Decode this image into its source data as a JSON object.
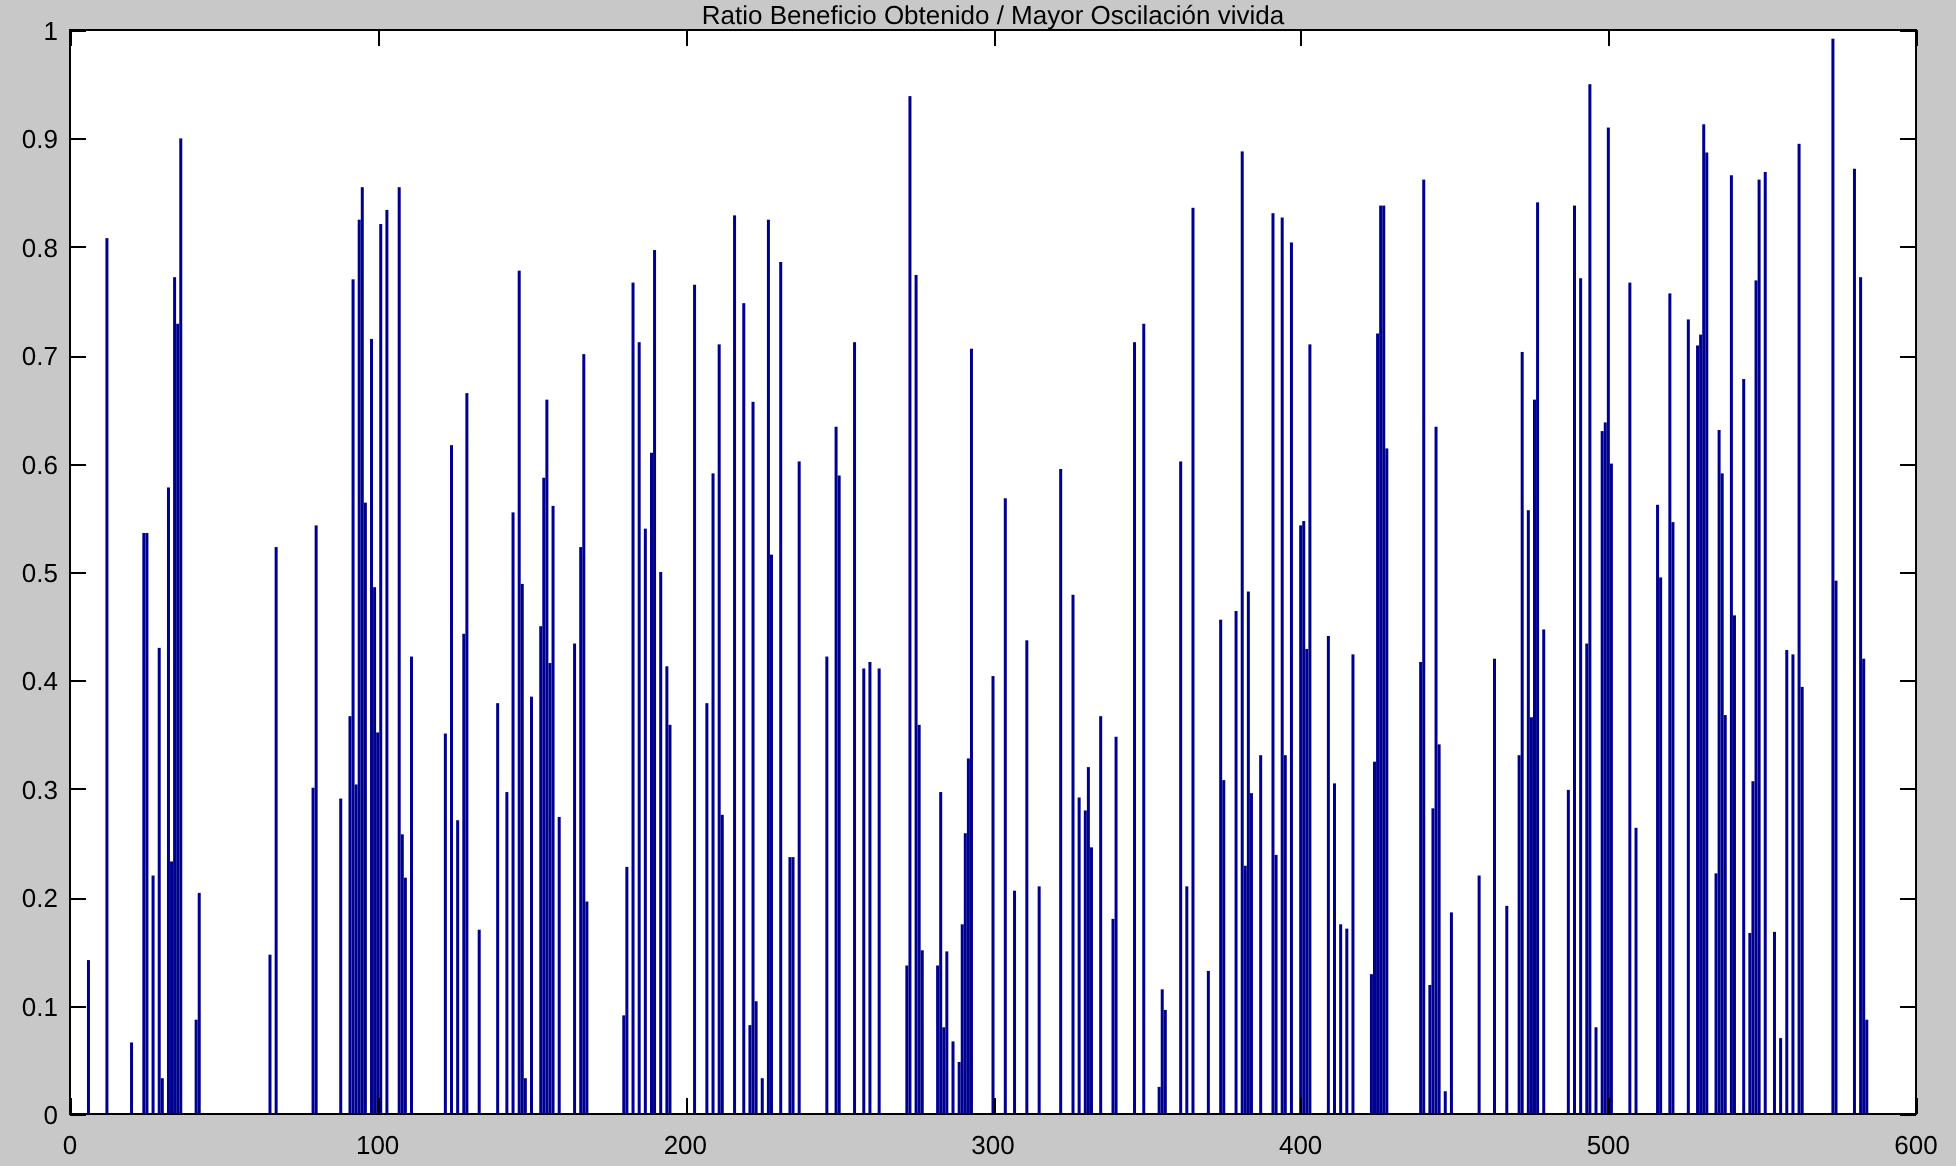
{
  "figure": {
    "chart_data": {
      "type": "bar",
      "title": "Ratio Beneficio Obtenido / Mayor Oscilación vivida",
      "xlim": [
        0,
        600
      ],
      "ylim": [
        0,
        1
      ],
      "xticks": [
        0,
        100,
        200,
        300,
        400,
        500,
        600
      ],
      "yticks": [
        0,
        0.1,
        0.2,
        0.3,
        0.4,
        0.5,
        0.6,
        0.7,
        0.8,
        0.9,
        1
      ],
      "x": [
        6,
        12,
        20,
        24,
        25,
        27,
        29,
        30,
        32,
        33,
        34,
        35,
        36,
        41,
        42,
        65,
        67,
        79,
        80,
        88,
        91,
        92,
        93,
        94,
        95,
        96,
        98,
        99,
        100,
        101,
        103,
        107,
        108,
        109,
        111,
        122,
        124,
        126,
        128,
        129,
        133,
        139,
        142,
        144,
        146,
        147,
        148,
        150,
        153,
        154,
        155,
        156,
        157,
        159,
        164,
        166,
        167,
        168,
        180,
        181,
        183,
        185,
        187,
        189,
        190,
        192,
        194,
        195,
        203,
        207,
        209,
        211,
        212,
        216,
        219,
        221,
        222,
        223,
        225,
        227,
        228,
        231,
        234,
        235,
        237,
        246,
        249,
        250,
        255,
        258,
        260,
        263,
        272,
        273,
        275,
        276,
        277,
        282,
        283,
        284,
        285,
        287,
        289,
        290,
        291,
        292,
        293,
        300,
        304,
        307,
        311,
        315,
        322,
        326,
        328,
        330,
        331,
        332,
        335,
        339,
        340,
        346,
        349,
        354,
        355,
        356,
        361,
        363,
        365,
        370,
        374,
        375,
        379,
        381,
        382,
        383,
        384,
        387,
        391,
        392,
        394,
        395,
        397,
        400,
        401,
        402,
        403,
        409,
        411,
        413,
        415,
        417,
        423,
        424,
        425,
        426,
        427,
        428,
        439,
        440,
        442,
        443,
        444,
        445,
        447,
        449,
        458,
        463,
        467,
        471,
        472,
        474,
        475,
        476,
        477,
        479,
        487,
        489,
        491,
        493,
        494,
        496,
        498,
        499,
        500,
        501,
        507,
        509,
        516,
        517,
        520,
        521,
        526,
        529,
        530,
        531,
        532,
        535,
        536,
        537,
        538,
        540,
        541,
        544,
        546,
        547,
        548,
        549,
        551,
        554,
        556,
        558,
        560,
        562,
        563,
        573,
        574,
        580,
        582,
        583,
        584
      ],
      "series": [
        {
          "color": "#00008f",
          "values": [
            0.142,
            0.808,
            0.066,
            0.536,
            0.536,
            0.22,
            0.43,
            0.033,
            0.578,
            0.233,
            0.772,
            0.729,
            0.9,
            0.087,
            0.204,
            0.147,
            0.523,
            0.301,
            0.543,
            0.291,
            0.367,
            0.77,
            0.304,
            0.825,
            0.855,
            0.564,
            0.715,
            0.486,
            0.352,
            0.821,
            0.834,
            0.855,
            0.258,
            0.218,
            0.422,
            0.351,
            0.617,
            0.271,
            0.443,
            0.665,
            0.17,
            0.379,
            0.297,
            0.555,
            0.778,
            0.489,
            0.033,
            0.385,
            0.45,
            0.587,
            0.659,
            0.416,
            0.561,
            0.274,
            0.434,
            0.523,
            0.701,
            0.196,
            0.091,
            0.228,
            0.767,
            0.712,
            0.54,
            0.61,
            0.797,
            0.5,
            0.413,
            0.359,
            0.765,
            0.379,
            0.591,
            0.71,
            0.276,
            0.829,
            0.748,
            0.082,
            0.657,
            0.104,
            0.033,
            0.825,
            0.516,
            0.786,
            0.237,
            0.237,
            0.602,
            0.422,
            0.634,
            0.589,
            0.712,
            0.411,
            0.417,
            0.411,
            0.137,
            0.939,
            0.774,
            0.359,
            0.151,
            0.137,
            0.297,
            0.08,
            0.15,
            0.067,
            0.048,
            0.175,
            0.259,
            0.328,
            0.706,
            0.404,
            0.568,
            0.206,
            0.437,
            0.21,
            0.595,
            0.479,
            0.292,
            0.28,
            0.32,
            0.246,
            0.367,
            0.18,
            0.348,
            0.712,
            0.729,
            0.025,
            0.115,
            0.096,
            0.602,
            0.21,
            0.836,
            0.132,
            0.456,
            0.308,
            0.464,
            0.888,
            0.229,
            0.482,
            0.296,
            0.331,
            0.831,
            0.239,
            0.827,
            0.331,
            0.804,
            0.543,
            0.547,
            0.429,
            0.71,
            0.441,
            0.305,
            0.175,
            0.171,
            0.424,
            0.129,
            0.325,
            0.72,
            0.838,
            0.838,
            0.614,
            0.417,
            0.862,
            0.119,
            0.282,
            0.634,
            0.341,
            0.021,
            0.186,
            0.22,
            0.42,
            0.192,
            0.331,
            0.703,
            0.557,
            0.366,
            0.659,
            0.841,
            0.447,
            0.299,
            0.838,
            0.771,
            0.434,
            0.95,
            0.08,
            0.63,
            0.638,
            0.91,
            0.6,
            0.767,
            0.264,
            0.562,
            0.495,
            0.757,
            0.546,
            0.733,
            0.709,
            0.719,
            0.913,
            0.887,
            0.222,
            0.631,
            0.591,
            0.368,
            0.866,
            0.46,
            0.678,
            0.167,
            0.307,
            0.769,
            0.862,
            0.869,
            0.168,
            0.07,
            0.428,
            0.424,
            0.895,
            0.394,
            0.992,
            0.492,
            0.872,
            0.772,
            0.42,
            0.087
          ]
        }
      ]
    }
  }
}
